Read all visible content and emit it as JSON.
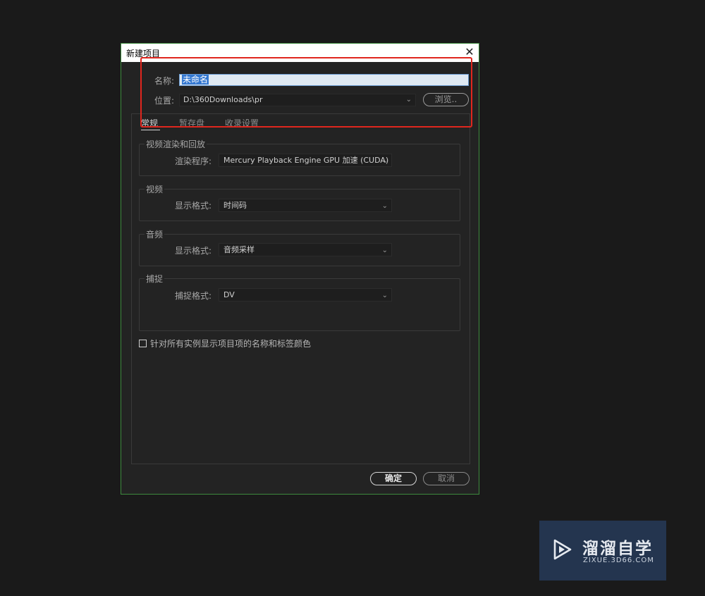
{
  "dialog": {
    "title": "新建项目",
    "close_glyph": "✕",
    "name_label": "名称:",
    "name_value": "未命名",
    "location_label": "位置:",
    "location_value": "D:\\360Downloads\\pr",
    "browse_label": "浏览..",
    "tabs": [
      {
        "label": "常规",
        "active": true
      },
      {
        "label": "暂存盘",
        "active": false
      },
      {
        "label": "收录设置",
        "active": false
      }
    ],
    "groups": {
      "video_render": {
        "title": "视频渲染和回放",
        "field_label": "渲染程序:",
        "value": "Mercury Playback Engine GPU 加速 (CUDA)"
      },
      "video": {
        "title": "视频",
        "field_label": "显示格式:",
        "value": "时间码"
      },
      "audio": {
        "title": "音频",
        "field_label": "显示格式:",
        "value": "音频采样"
      },
      "capture": {
        "title": "捕捉",
        "field_label": "捕捉格式:",
        "value": "DV"
      }
    },
    "checkbox_label": "针对所有实例显示项目项的名称和标签颜色",
    "checkbox_checked": false,
    "ok_label": "确定",
    "cancel_label": "取消"
  },
  "watermark": {
    "title": "溜溜自学",
    "subtitle": "ZIXUE.3D66.COM",
    "icon": "play-icon"
  },
  "annotation_color": "#e0261e"
}
